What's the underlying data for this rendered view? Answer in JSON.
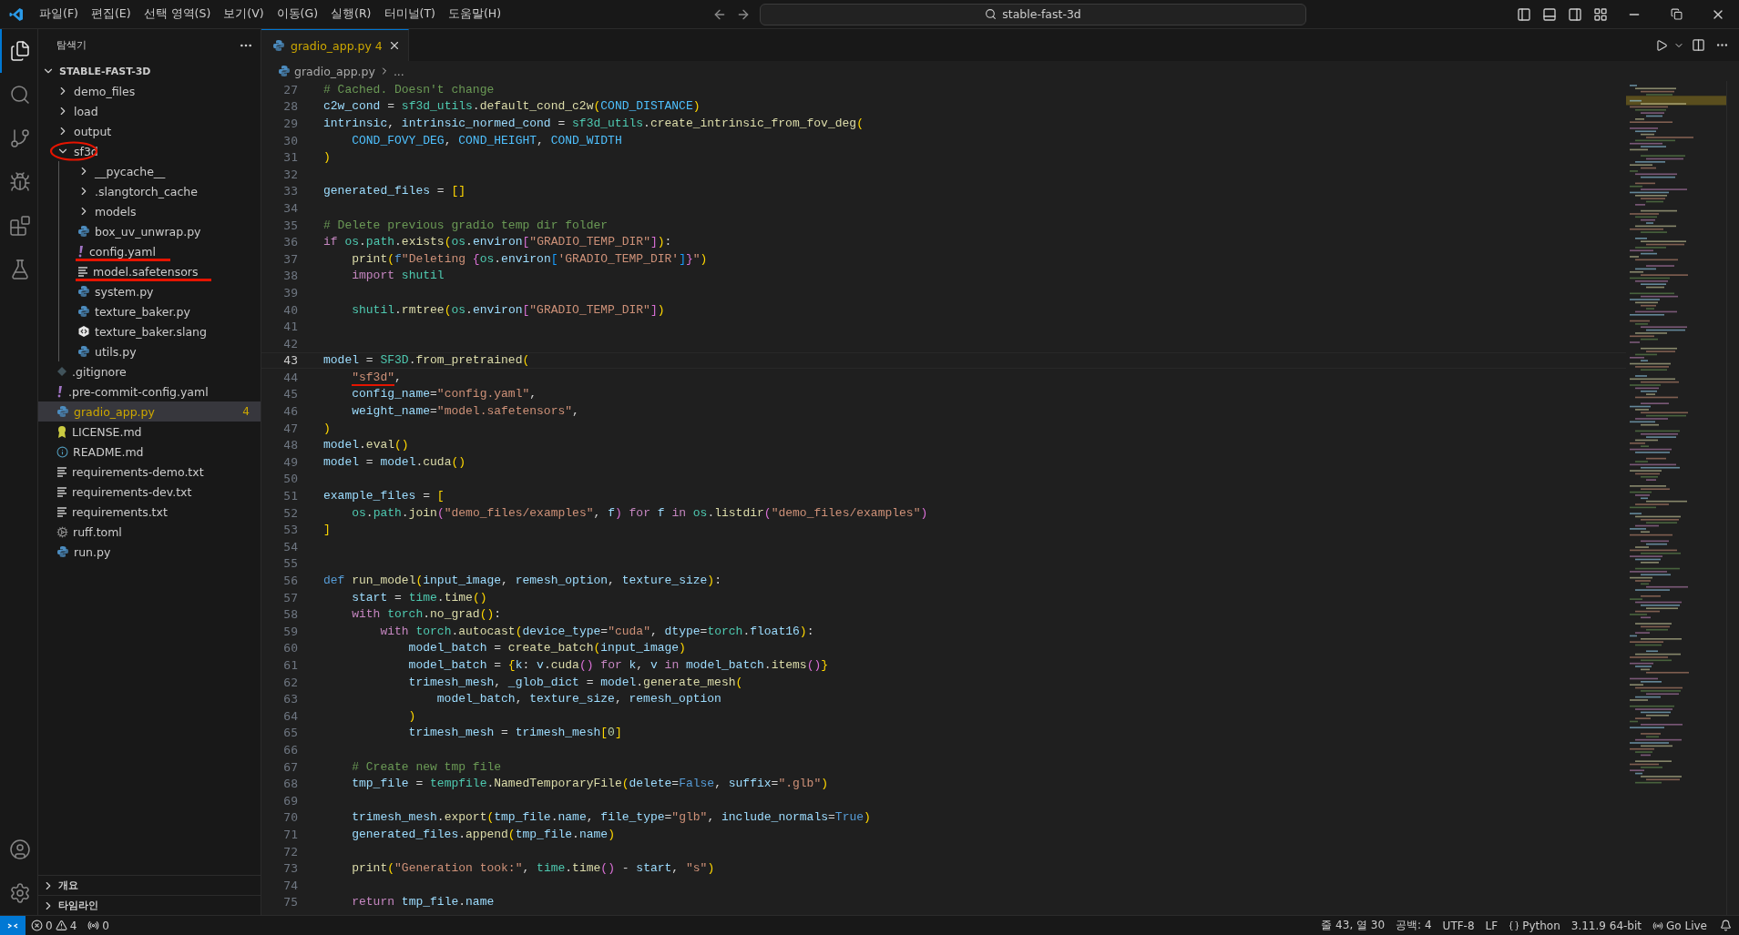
{
  "menu": [
    "파일(F)",
    "편집(E)",
    "선택 영역(S)",
    "보기(V)",
    "이동(G)",
    "실행(R)",
    "터미널(T)",
    "도움말(H)"
  ],
  "command_center": {
    "value": "stable-fast-3d"
  },
  "activity_bar": [
    {
      "kind": "files",
      "selected": true
    },
    {
      "kind": "search",
      "selected": false
    },
    {
      "kind": "git",
      "selected": false
    },
    {
      "kind": "debug",
      "selected": false
    },
    {
      "kind": "extensions",
      "selected": false
    },
    {
      "kind": "testing",
      "selected": false
    }
  ],
  "activity_bar_bottom": [
    {
      "kind": "account"
    },
    {
      "kind": "settings"
    }
  ],
  "sidebar": {
    "title": "탐색기",
    "root": {
      "label": "STABLE-FAST-3D",
      "expanded": true
    },
    "tree": [
      {
        "label": "demo_files",
        "kind": "folder",
        "expanded": false,
        "selected": false
      },
      {
        "label": "load",
        "kind": "folder",
        "expanded": false,
        "selected": false
      },
      {
        "label": "output",
        "kind": "folder",
        "expanded": false,
        "selected": false
      },
      {
        "label": "sf3d",
        "kind": "folder",
        "expanded": true,
        "selected": false,
        "circled": true,
        "children": [
          {
            "label": "__pycache__",
            "kind": "folder",
            "expanded": false,
            "selected": false
          },
          {
            "label": ".slangtorch_cache",
            "kind": "folder",
            "expanded": false,
            "selected": false
          },
          {
            "label": "models",
            "kind": "folder",
            "expanded": false,
            "selected": false
          },
          {
            "label": "box_uv_unwrap.py",
            "kind": "python",
            "selected": false
          },
          {
            "label": "config.yaml",
            "kind": "yaml",
            "selected": false,
            "underlined": true
          },
          {
            "label": "model.safetensors",
            "kind": "text",
            "selected": false,
            "underlined": true
          },
          {
            "label": "system.py",
            "kind": "python",
            "selected": false
          },
          {
            "label": "texture_baker.py",
            "kind": "python",
            "selected": false
          },
          {
            "label": "texture_baker.slang",
            "kind": "slang",
            "selected": false
          },
          {
            "label": "utils.py",
            "kind": "python",
            "selected": false
          }
        ]
      },
      {
        "label": ".gitignore",
        "kind": "git",
        "selected": false
      },
      {
        "label": ".pre-commit-config.yaml",
        "kind": "yaml",
        "selected": false
      },
      {
        "label": "gradio_app.py",
        "kind": "python",
        "selected": true,
        "badge": "4"
      },
      {
        "label": "LICENSE.md",
        "kind": "license",
        "selected": false
      },
      {
        "label": "README.md",
        "kind": "info",
        "selected": false
      },
      {
        "label": "requirements-demo.txt",
        "kind": "text",
        "selected": false
      },
      {
        "label": "requirements-dev.txt",
        "kind": "text",
        "selected": false
      },
      {
        "label": "requirements.txt",
        "kind": "text",
        "selected": false
      },
      {
        "label": "ruff.toml",
        "kind": "gear",
        "selected": false
      },
      {
        "label": "run.py",
        "kind": "python",
        "selected": false
      }
    ],
    "sections": [
      {
        "label": "개요",
        "expanded": false
      },
      {
        "label": "타임라인",
        "expanded": false
      }
    ]
  },
  "tabs": [
    {
      "label": "gradio_app.py",
      "badge": "4",
      "selected": true
    }
  ],
  "breadcrumb": [
    "gradio_app.py",
    "..."
  ],
  "editor": {
    "lines": [
      {
        "n": "27",
        "tokens": [
          {
            "text": "# Cached. Doesn't change",
            "kind": "comment"
          }
        ]
      },
      {
        "n": "28",
        "tokens": [
          {
            "text": "c2w_cond",
            "kind": "var"
          },
          {
            "text": " = ",
            "kind": "op"
          },
          {
            "text": "sf3d_utils",
            "kind": "type"
          },
          {
            "text": ".",
            "kind": "op"
          },
          {
            "text": "default_cond_c2w",
            "kind": "func"
          },
          {
            "text": "(",
            "kind": "br1"
          },
          {
            "text": "COND_DISTANCE",
            "kind": "const"
          },
          {
            "text": ")",
            "kind": "br1"
          }
        ]
      },
      {
        "n": "29",
        "tokens": [
          {
            "text": "intrinsic",
            "kind": "var"
          },
          {
            "text": ", ",
            "kind": "op"
          },
          {
            "text": "intrinsic_normed_cond",
            "kind": "var"
          },
          {
            "text": " = ",
            "kind": "op"
          },
          {
            "text": "sf3d_utils",
            "kind": "type"
          },
          {
            "text": ".",
            "kind": "op"
          },
          {
            "text": "create_intrinsic_from_fov_deg",
            "kind": "func"
          },
          {
            "text": "(",
            "kind": "br1"
          }
        ]
      },
      {
        "n": "30",
        "tokens": [
          {
            "text": "    COND_FOVY_DEG",
            "kind": "const"
          },
          {
            "text": ", ",
            "kind": "op"
          },
          {
            "text": "COND_HEIGHT",
            "kind": "const"
          },
          {
            "text": ", ",
            "kind": "op"
          },
          {
            "text": "COND_WIDTH",
            "kind": "const"
          }
        ]
      },
      {
        "n": "31",
        "tokens": [
          {
            "text": ")",
            "kind": "br1"
          }
        ]
      },
      {
        "n": "32"
      },
      {
        "n": "33",
        "tokens": [
          {
            "text": "generated_files",
            "kind": "var"
          },
          {
            "text": " = ",
            "kind": "op"
          },
          {
            "text": "[]",
            "kind": "br1"
          }
        ]
      },
      {
        "n": "34"
      },
      {
        "n": "35",
        "tokens": [
          {
            "text": "# Delete previous gradio temp dir folder",
            "kind": "comment"
          }
        ]
      },
      {
        "n": "36",
        "tokens": [
          {
            "text": "if ",
            "kind": "keyword"
          },
          {
            "text": "os",
            "kind": "type"
          },
          {
            "text": ".",
            "kind": "op"
          },
          {
            "text": "path",
            "kind": "type"
          },
          {
            "text": ".",
            "kind": "op"
          },
          {
            "text": "exists",
            "kind": "func"
          },
          {
            "text": "(",
            "kind": "br1"
          },
          {
            "text": "os",
            "kind": "type"
          },
          {
            "text": ".",
            "kind": "op"
          },
          {
            "text": "environ",
            "kind": "var"
          },
          {
            "text": "[",
            "kind": "br2"
          },
          {
            "text": "\"GRADIO_TEMP_DIR\"",
            "kind": "string"
          },
          {
            "text": "]",
            "kind": "br2"
          },
          {
            "text": ")",
            "kind": "br1"
          },
          {
            "text": ":",
            "kind": "op"
          }
        ]
      },
      {
        "n": "37",
        "tokens": [
          {
            "text": "    print",
            "kind": "func"
          },
          {
            "text": "(",
            "kind": "br1"
          },
          {
            "text": "f",
            "kind": "storage"
          },
          {
            "text": "\"Deleting ",
            "kind": "string"
          },
          {
            "text": "{",
            "kind": "br2"
          },
          {
            "text": "os",
            "kind": "type"
          },
          {
            "text": ".",
            "kind": "op"
          },
          {
            "text": "environ",
            "kind": "var"
          },
          {
            "text": "[",
            "kind": "br3"
          },
          {
            "text": "'GRADIO_TEMP_DIR'",
            "kind": "string"
          },
          {
            "text": "]",
            "kind": "br3"
          },
          {
            "text": "}",
            "kind": "br2"
          },
          {
            "text": "\"",
            "kind": "string"
          },
          {
            "text": ")",
            "kind": "br1"
          }
        ]
      },
      {
        "n": "38",
        "tokens": [
          {
            "text": "    import ",
            "kind": "keyword"
          },
          {
            "text": "shutil",
            "kind": "type"
          }
        ]
      },
      {
        "n": "39"
      },
      {
        "n": "40",
        "tokens": [
          {
            "text": "    shutil",
            "kind": "type"
          },
          {
            "text": ".",
            "kind": "op"
          },
          {
            "text": "rmtree",
            "kind": "func"
          },
          {
            "text": "(",
            "kind": "br1"
          },
          {
            "text": "os",
            "kind": "type"
          },
          {
            "text": ".",
            "kind": "op"
          },
          {
            "text": "environ",
            "kind": "var"
          },
          {
            "text": "[",
            "kind": "br2"
          },
          {
            "text": "\"GRADIO_TEMP_DIR\"",
            "kind": "string"
          },
          {
            "text": "]",
            "kind": "br2"
          },
          {
            "text": ")",
            "kind": "br1"
          }
        ]
      },
      {
        "n": "41"
      },
      {
        "n": "42"
      },
      {
        "n": "43",
        "current": true,
        "tokens": [
          {
            "text": "model",
            "kind": "var"
          },
          {
            "text": " = ",
            "kind": "op"
          },
          {
            "text": "SF3D",
            "kind": "type"
          },
          {
            "text": ".",
            "kind": "op"
          },
          {
            "text": "from_pretrained",
            "kind": "func"
          },
          {
            "text": "(",
            "kind": "br1"
          }
        ]
      },
      {
        "n": "44",
        "tokens": [
          {
            "text": "\"sf3d\"",
            "kind": "string",
            "indent": true,
            "underlined": true
          },
          {
            "text": ",",
            "kind": "op"
          }
        ]
      },
      {
        "n": "45",
        "tokens": [
          {
            "text": "    config_name",
            "kind": "var"
          },
          {
            "text": "=",
            "kind": "op"
          },
          {
            "text": "\"config.yaml\"",
            "kind": "string"
          },
          {
            "text": ",",
            "kind": "op"
          }
        ]
      },
      {
        "n": "46",
        "tokens": [
          {
            "text": "    weight_name",
            "kind": "var"
          },
          {
            "text": "=",
            "kind": "op"
          },
          {
            "text": "\"model.safetensors\"",
            "kind": "string"
          },
          {
            "text": ",",
            "kind": "op"
          }
        ]
      },
      {
        "n": "47",
        "tokens": [
          {
            "text": ")",
            "kind": "br1"
          }
        ]
      },
      {
        "n": "48",
        "tokens": [
          {
            "text": "model",
            "kind": "var"
          },
          {
            "text": ".",
            "kind": "op"
          },
          {
            "text": "eval",
            "kind": "func"
          },
          {
            "text": "()",
            "kind": "br1"
          }
        ]
      },
      {
        "n": "49",
        "tokens": [
          {
            "text": "model",
            "kind": "var"
          },
          {
            "text": " = ",
            "kind": "op"
          },
          {
            "text": "model",
            "kind": "var"
          },
          {
            "text": ".",
            "kind": "op"
          },
          {
            "text": "cuda",
            "kind": "func"
          },
          {
            "text": "()",
            "kind": "br1"
          }
        ]
      },
      {
        "n": "50"
      },
      {
        "n": "51",
        "tokens": [
          {
            "text": "example_files",
            "kind": "var"
          },
          {
            "text": " = ",
            "kind": "op"
          },
          {
            "text": "[",
            "kind": "br1"
          }
        ]
      },
      {
        "n": "52",
        "tokens": [
          {
            "text": "    os",
            "kind": "type"
          },
          {
            "text": ".",
            "kind": "op"
          },
          {
            "text": "path",
            "kind": "type"
          },
          {
            "text": ".",
            "kind": "op"
          },
          {
            "text": "join",
            "kind": "func"
          },
          {
            "text": "(",
            "kind": "br2"
          },
          {
            "text": "\"demo_files/examples\"",
            "kind": "string"
          },
          {
            "text": ", ",
            "kind": "op"
          },
          {
            "text": "f",
            "kind": "var"
          },
          {
            "text": ") ",
            "kind": "br2"
          },
          {
            "text": "for ",
            "kind": "keyword"
          },
          {
            "text": "f ",
            "kind": "var"
          },
          {
            "text": "in ",
            "kind": "keyword"
          },
          {
            "text": "os",
            "kind": "type"
          },
          {
            "text": ".",
            "kind": "op"
          },
          {
            "text": "listdir",
            "kind": "func"
          },
          {
            "text": "(",
            "kind": "br2"
          },
          {
            "text": "\"demo_files/examples\"",
            "kind": "string"
          },
          {
            "text": ")",
            "kind": "br2"
          }
        ]
      },
      {
        "n": "53",
        "tokens": [
          {
            "text": "]",
            "kind": "br1"
          }
        ]
      },
      {
        "n": "54"
      },
      {
        "n": "55"
      },
      {
        "n": "56",
        "tokens": [
          {
            "text": "def ",
            "kind": "storage"
          },
          {
            "text": "run_model",
            "kind": "func"
          },
          {
            "text": "(",
            "kind": "br1"
          },
          {
            "text": "input_image",
            "kind": "var"
          },
          {
            "text": ", ",
            "kind": "op"
          },
          {
            "text": "remesh_option",
            "kind": "var"
          },
          {
            "text": ", ",
            "kind": "op"
          },
          {
            "text": "texture_size",
            "kind": "var"
          },
          {
            "text": ")",
            "kind": "br1"
          },
          {
            "text": ":",
            "kind": "op"
          }
        ]
      },
      {
        "n": "57",
        "tokens": [
          {
            "text": "    start",
            "kind": "var"
          },
          {
            "text": " = ",
            "kind": "op"
          },
          {
            "text": "time",
            "kind": "type"
          },
          {
            "text": ".",
            "kind": "op"
          },
          {
            "text": "time",
            "kind": "func"
          },
          {
            "text": "()",
            "kind": "br1"
          }
        ]
      },
      {
        "n": "58",
        "tokens": [
          {
            "text": "    with ",
            "kind": "keyword"
          },
          {
            "text": "torch",
            "kind": "type"
          },
          {
            "text": ".",
            "kind": "op"
          },
          {
            "text": "no_grad",
            "kind": "func"
          },
          {
            "text": "()",
            "kind": "br1"
          },
          {
            "text": ":",
            "kind": "op"
          }
        ]
      },
      {
        "n": "59",
        "tokens": [
          {
            "text": "        with ",
            "kind": "keyword"
          },
          {
            "text": "torch",
            "kind": "type"
          },
          {
            "text": ".",
            "kind": "op"
          },
          {
            "text": "autocast",
            "kind": "func"
          },
          {
            "text": "(",
            "kind": "br1"
          },
          {
            "text": "device_type",
            "kind": "var"
          },
          {
            "text": "=",
            "kind": "op"
          },
          {
            "text": "\"cuda\"",
            "kind": "string"
          },
          {
            "text": ", ",
            "kind": "op"
          },
          {
            "text": "dtype",
            "kind": "var"
          },
          {
            "text": "=",
            "kind": "op"
          },
          {
            "text": "torch",
            "kind": "type"
          },
          {
            "text": ".",
            "kind": "op"
          },
          {
            "text": "float16",
            "kind": "var"
          },
          {
            "text": ")",
            "kind": "br1"
          },
          {
            "text": ":",
            "kind": "op"
          }
        ]
      },
      {
        "n": "60",
        "tokens": [
          {
            "text": "            model_batch",
            "kind": "var"
          },
          {
            "text": " = ",
            "kind": "op"
          },
          {
            "text": "create_batch",
            "kind": "func"
          },
          {
            "text": "(",
            "kind": "br1"
          },
          {
            "text": "input_image",
            "kind": "var"
          },
          {
            "text": ")",
            "kind": "br1"
          }
        ]
      },
      {
        "n": "61",
        "tokens": [
          {
            "text": "            model_batch",
            "kind": "var"
          },
          {
            "text": " = ",
            "kind": "op"
          },
          {
            "text": "{",
            "kind": "br1"
          },
          {
            "text": "k",
            "kind": "var"
          },
          {
            "text": ": ",
            "kind": "op"
          },
          {
            "text": "v",
            "kind": "var"
          },
          {
            "text": ".",
            "kind": "op"
          },
          {
            "text": "cuda",
            "kind": "func"
          },
          {
            "text": "() ",
            "kind": "br2"
          },
          {
            "text": "for ",
            "kind": "keyword"
          },
          {
            "text": "k",
            "kind": "var"
          },
          {
            "text": ", ",
            "kind": "op"
          },
          {
            "text": "v ",
            "kind": "var"
          },
          {
            "text": "in ",
            "kind": "keyword"
          },
          {
            "text": "model_batch",
            "kind": "var"
          },
          {
            "text": ".",
            "kind": "op"
          },
          {
            "text": "items",
            "kind": "func"
          },
          {
            "text": "()",
            "kind": "br2"
          },
          {
            "text": "}",
            "kind": "br1"
          }
        ]
      },
      {
        "n": "62",
        "tokens": [
          {
            "text": "            trimesh_mesh",
            "kind": "var"
          },
          {
            "text": ", ",
            "kind": "op"
          },
          {
            "text": "_glob_dict",
            "kind": "var"
          },
          {
            "text": " = ",
            "kind": "op"
          },
          {
            "text": "model",
            "kind": "var"
          },
          {
            "text": ".",
            "kind": "op"
          },
          {
            "text": "generate_mesh",
            "kind": "func"
          },
          {
            "text": "(",
            "kind": "br1"
          }
        ]
      },
      {
        "n": "63",
        "tokens": [
          {
            "text": "                model_batch",
            "kind": "var"
          },
          {
            "text": ", ",
            "kind": "op"
          },
          {
            "text": "texture_size",
            "kind": "var"
          },
          {
            "text": ", ",
            "kind": "op"
          },
          {
            "text": "remesh_option",
            "kind": "var"
          }
        ]
      },
      {
        "n": "64",
        "tokens": [
          {
            "text": "            )",
            "kind": "br1"
          }
        ]
      },
      {
        "n": "65",
        "tokens": [
          {
            "text": "            trimesh_mesh",
            "kind": "var"
          },
          {
            "text": " = ",
            "kind": "op"
          },
          {
            "text": "trimesh_mesh",
            "kind": "var"
          },
          {
            "text": "[",
            "kind": "br1"
          },
          {
            "text": "0",
            "kind": "number"
          },
          {
            "text": "]",
            "kind": "br1"
          }
        ]
      },
      {
        "n": "66"
      },
      {
        "n": "67",
        "tokens": [
          {
            "text": "    # Create new tmp file",
            "kind": "comment"
          }
        ]
      },
      {
        "n": "68",
        "tokens": [
          {
            "text": "    tmp_file",
            "kind": "var"
          },
          {
            "text": " = ",
            "kind": "op"
          },
          {
            "text": "tempfile",
            "kind": "type"
          },
          {
            "text": ".",
            "kind": "op"
          },
          {
            "text": "NamedTemporaryFile",
            "kind": "func"
          },
          {
            "text": "(",
            "kind": "br1"
          },
          {
            "text": "delete",
            "kind": "var"
          },
          {
            "text": "=",
            "kind": "op"
          },
          {
            "text": "False",
            "kind": "storage"
          },
          {
            "text": ", ",
            "kind": "op"
          },
          {
            "text": "suffix",
            "kind": "var"
          },
          {
            "text": "=",
            "kind": "op"
          },
          {
            "text": "\".glb\"",
            "kind": "string"
          },
          {
            "text": ")",
            "kind": "br1"
          }
        ]
      },
      {
        "n": "69"
      },
      {
        "n": "70",
        "tokens": [
          {
            "text": "    trimesh_mesh",
            "kind": "var"
          },
          {
            "text": ".",
            "kind": "op"
          },
          {
            "text": "export",
            "kind": "func"
          },
          {
            "text": "(",
            "kind": "br1"
          },
          {
            "text": "tmp_file",
            "kind": "var"
          },
          {
            "text": ".",
            "kind": "op"
          },
          {
            "text": "name",
            "kind": "var"
          },
          {
            "text": ", ",
            "kind": "op"
          },
          {
            "text": "file_type",
            "kind": "var"
          },
          {
            "text": "=",
            "kind": "op"
          },
          {
            "text": "\"glb\"",
            "kind": "string"
          },
          {
            "text": ", ",
            "kind": "op"
          },
          {
            "text": "include_normals",
            "kind": "var"
          },
          {
            "text": "=",
            "kind": "op"
          },
          {
            "text": "True",
            "kind": "storage"
          },
          {
            "text": ")",
            "kind": "br1"
          }
        ]
      },
      {
        "n": "71",
        "tokens": [
          {
            "text": "    generated_files",
            "kind": "var"
          },
          {
            "text": ".",
            "kind": "op"
          },
          {
            "text": "append",
            "kind": "func"
          },
          {
            "text": "(",
            "kind": "br1"
          },
          {
            "text": "tmp_file",
            "kind": "var"
          },
          {
            "text": ".",
            "kind": "op"
          },
          {
            "text": "name",
            "kind": "var"
          },
          {
            "text": ")",
            "kind": "br1"
          }
        ]
      },
      {
        "n": "72"
      },
      {
        "n": "73",
        "tokens": [
          {
            "text": "    print",
            "kind": "func"
          },
          {
            "text": "(",
            "kind": "br1"
          },
          {
            "text": "\"Generation took:\"",
            "kind": "string"
          },
          {
            "text": ", ",
            "kind": "op"
          },
          {
            "text": "time",
            "kind": "type"
          },
          {
            "text": ".",
            "kind": "op"
          },
          {
            "text": "time",
            "kind": "func"
          },
          {
            "text": "()",
            "kind": "br2"
          },
          {
            "text": " - ",
            "kind": "op"
          },
          {
            "text": "start",
            "kind": "var"
          },
          {
            "text": ", ",
            "kind": "op"
          },
          {
            "text": "\"s\"",
            "kind": "string"
          },
          {
            "text": ")",
            "kind": "br1"
          }
        ]
      },
      {
        "n": "74"
      },
      {
        "n": "75",
        "tokens": [
          {
            "text": "    return ",
            "kind": "keyword"
          },
          {
            "text": "tmp_file",
            "kind": "var"
          },
          {
            "text": ".",
            "kind": "op"
          },
          {
            "text": "name",
            "kind": "var"
          }
        ]
      }
    ]
  },
  "status_bar": {
    "errors": "0",
    "warnings": "4",
    "ports": "0",
    "right": [
      {
        "text": "줄 43, 열 30"
      },
      {
        "text": "공백: 4"
      },
      {
        "text": "UTF-8"
      },
      {
        "text": "LF"
      },
      {
        "text": "Python",
        "kind": "language"
      },
      {
        "text": "3.11.9 64-bit"
      },
      {
        "text": "Go Live",
        "kind": "live"
      }
    ]
  }
}
